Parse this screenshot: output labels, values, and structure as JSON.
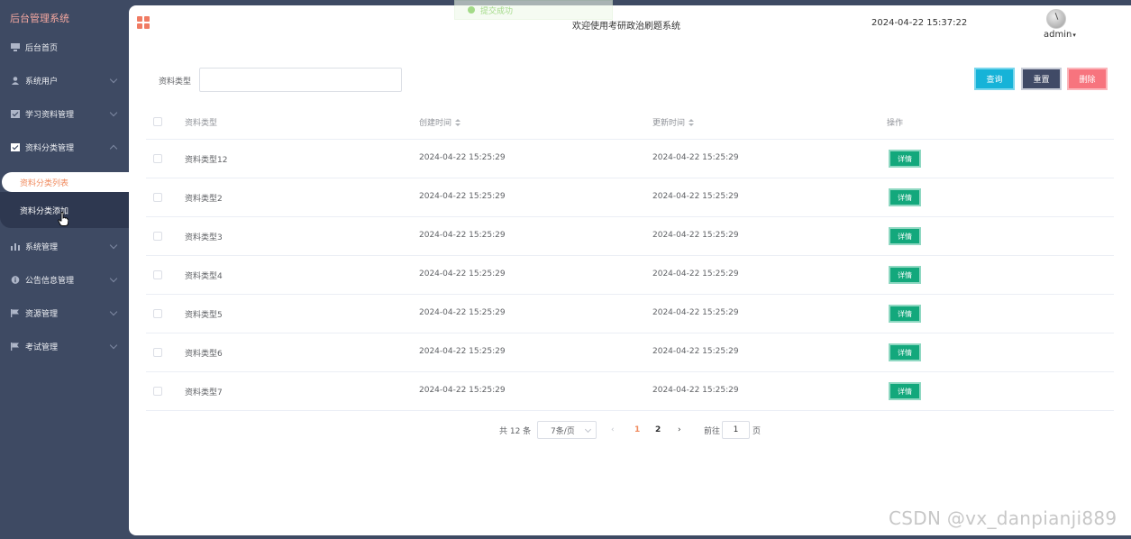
{
  "sidebar": {
    "brand": "后台管理系统",
    "items": [
      {
        "label": "后台首页",
        "icon": "monitor-icon"
      },
      {
        "label": "系统用户",
        "icon": "user-icon"
      },
      {
        "label": "学习资料管理",
        "icon": "checkbox-icon"
      },
      {
        "label": "资料分类管理",
        "icon": "checkbox-icon"
      },
      {
        "label": "系统管理",
        "icon": "bar-chart-icon"
      },
      {
        "label": "公告信息管理",
        "icon": "info-icon"
      },
      {
        "label": "资源管理",
        "icon": "flag-icon"
      },
      {
        "label": "考试管理",
        "icon": "flag-icon"
      }
    ],
    "sub_items": [
      {
        "label": "资料分类列表",
        "active": true
      },
      {
        "label": "资料分类添加",
        "active": false
      }
    ]
  },
  "header": {
    "toast": "提交成功",
    "welcome": "欢迎使用考研政治刷题系统",
    "datetime": "2024-04-22 15:37:22",
    "username": "admin",
    "caret": "▾"
  },
  "search": {
    "label": "资料类型",
    "value": "",
    "buttons": {
      "search": "查询",
      "reset": "重置",
      "delete": "删除"
    }
  },
  "table": {
    "headers": [
      "资料类型",
      "创建时间",
      "更新时间",
      "操作"
    ],
    "action_label": "详情",
    "rows": [
      {
        "type": "资料类型12",
        "created": "2024-04-22 15:25:29",
        "updated": "2024-04-22 15:25:29"
      },
      {
        "type": "资料类型2",
        "created": "2024-04-22 15:25:29",
        "updated": "2024-04-22 15:25:29"
      },
      {
        "type": "资料类型3",
        "created": "2024-04-22 15:25:29",
        "updated": "2024-04-22 15:25:29"
      },
      {
        "type": "资料类型4",
        "created": "2024-04-22 15:25:29",
        "updated": "2024-04-22 15:25:29"
      },
      {
        "type": "资料类型5",
        "created": "2024-04-22 15:25:29",
        "updated": "2024-04-22 15:25:29"
      },
      {
        "type": "资料类型6",
        "created": "2024-04-22 15:25:29",
        "updated": "2024-04-22 15:25:29"
      },
      {
        "type": "资料类型7",
        "created": "2024-04-22 15:25:29",
        "updated": "2024-04-22 15:25:29"
      }
    ]
  },
  "pagination": {
    "total": "共 12 条",
    "page_size": "7条/页",
    "prev": "‹",
    "pages": [
      "1",
      "2"
    ],
    "next": "›",
    "goto_label": "前往",
    "goto_value": "1",
    "page_suffix": "页"
  },
  "watermark": "CSDN @vx_danpianji889",
  "colors": {
    "sidebar_bg": "#3e4a63",
    "accent": "#f08a5d",
    "search_btn": "#16b3d8",
    "reset_btn": "#404a66",
    "delete_btn": "#f7747e",
    "detail_btn": "#13a87c"
  }
}
